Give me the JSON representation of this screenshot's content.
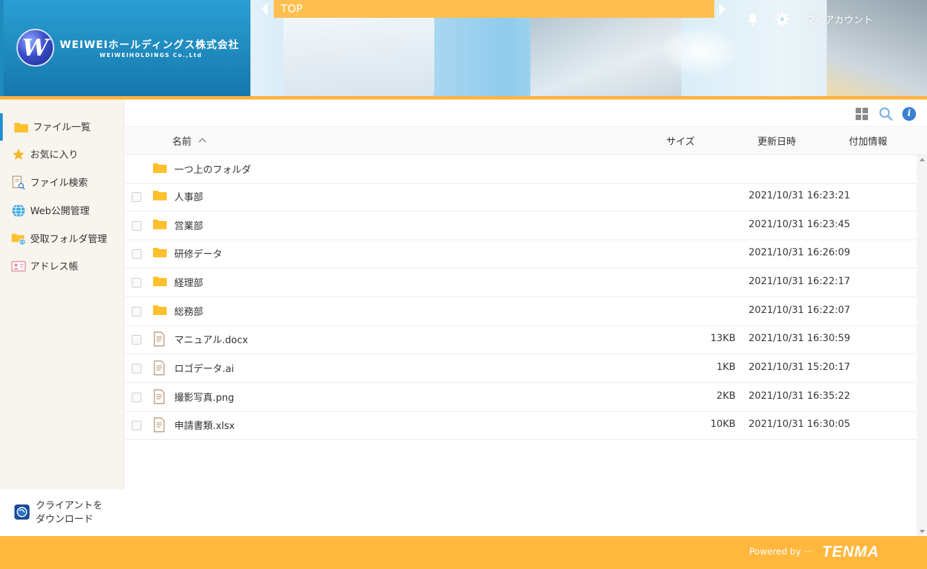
{
  "header": {
    "company_name": "WEIWEIホールディングス株式会社",
    "company_sub": "WEIWEIHOLDINGS Co.,Ltd",
    "logo_letter": "W",
    "breadcrumb": "TOP",
    "account_label": "マイアカウント",
    "accent_color": "#ffbf4f"
  },
  "sidebar": {
    "items": [
      {
        "label": "ファイル一覧",
        "icon": "folder-icon"
      },
      {
        "label": "お気に入り",
        "icon": "star-icon"
      },
      {
        "label": "ファイル検索",
        "icon": "file-search-icon"
      },
      {
        "label": "Web公開管理",
        "icon": "globe-icon"
      },
      {
        "label": "受取フォルダ管理",
        "icon": "folder-globe-icon"
      },
      {
        "label": "アドレス帳",
        "icon": "address-card-icon"
      }
    ],
    "download_label_1": "クライアントを",
    "download_label_2": "ダウンロード"
  },
  "columns": {
    "name": "名前",
    "size": "サイズ",
    "updated": "更新日時",
    "extra": "付加情報"
  },
  "files": [
    {
      "name": "一つ上のフォルダ",
      "type": "folder",
      "size": "",
      "date": "",
      "checkbox": false
    },
    {
      "name": "人事部",
      "type": "folder",
      "size": "",
      "date": "2021/10/31 16:23:21",
      "checkbox": true
    },
    {
      "name": "営業部",
      "type": "folder",
      "size": "",
      "date": "2021/10/31 16:23:45",
      "checkbox": true
    },
    {
      "name": "研修データ",
      "type": "folder",
      "size": "",
      "date": "2021/10/31 16:26:09",
      "checkbox": true
    },
    {
      "name": "経理部",
      "type": "folder",
      "size": "",
      "date": "2021/10/31 16:22:17",
      "checkbox": true
    },
    {
      "name": "総務部",
      "type": "folder",
      "size": "",
      "date": "2021/10/31 16:22:07",
      "checkbox": true
    },
    {
      "name": "マニュアル.docx",
      "type": "file",
      "size": "13KB",
      "date": "2021/10/31 16:30:59",
      "checkbox": true
    },
    {
      "name": "ロゴデータ.ai",
      "type": "file",
      "size": "1KB",
      "date": "2021/10/31 15:20:17",
      "checkbox": true
    },
    {
      "name": "撮影写真.png",
      "type": "file",
      "size": "2KB",
      "date": "2021/10/31 16:35:22",
      "checkbox": true
    },
    {
      "name": "申請書類.xlsx",
      "type": "file",
      "size": "10KB",
      "date": "2021/10/31 16:30:05",
      "checkbox": true
    }
  ],
  "footer": {
    "powered_by": "Powered by ···",
    "brand": "TENMA"
  }
}
